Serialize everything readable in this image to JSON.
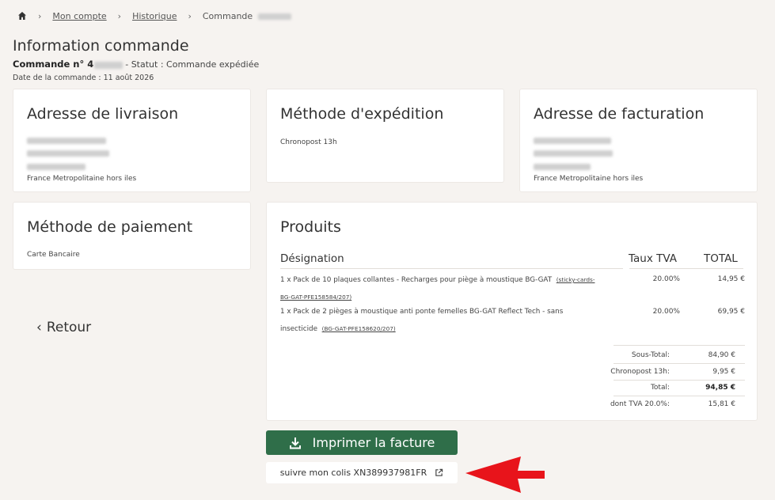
{
  "breadcrumb": {
    "home_icon": "home-icon",
    "items": [
      "Mon compte",
      "Historique"
    ],
    "current": "Commande"
  },
  "page_title": "Information commande",
  "order": {
    "label": "Commande n° 4",
    "status": "- Statut : Commande expédiée",
    "date": "Date de la commande : 11 août 2026"
  },
  "shipping_address": {
    "title": "Adresse de livraison",
    "country": "France Metropolitaine hors iles"
  },
  "shipping_method": {
    "title": "Méthode d'expédition",
    "value": "Chronopost 13h"
  },
  "billing_address": {
    "title": "Adresse de facturation",
    "country": "France Metropolitaine hors iles"
  },
  "payment": {
    "title": "Méthode de paiement",
    "value": "Carte Bancaire"
  },
  "back_label": "Retour",
  "products": {
    "title": "Produits",
    "headers": [
      "Désignation",
      "Taux TVA",
      "TOTAL"
    ],
    "rows": [
      {
        "line1": "1 x Pack de 10 plaques collantes - Recharges pour piège à moustique BG-GAT",
        "ref1": "(sticky-cards-",
        "ref2": "BG-GAT-PFE158584/207)",
        "tva": "20.00%",
        "total": "14,95 €"
      },
      {
        "line1": "1 x Pack de 2 pièges à moustique anti ponte femelles BG-GAT Reflect Tech - sans",
        "line2": "insecticide",
        "ref": "(BG-GAT-PFE158620/207)",
        "tva": "20.00%",
        "total": "69,95 €"
      }
    ],
    "totals": [
      {
        "label": "Sous-Total:",
        "value": "84,90 €"
      },
      {
        "label": "Chronopost 13h:",
        "value": "9,95 €"
      },
      {
        "label": "Total:",
        "value": "94,85 €"
      },
      {
        "label": "dont TVA 20.0%:",
        "value": "15,81 €"
      }
    ]
  },
  "print_button": "Imprimer la facture",
  "track_button": "suivre mon colis XN389937981FR",
  "colors": {
    "background": "#f6f3f0",
    "primary_button": "#2f6e49",
    "annotation_arrow": "#e8141b"
  }
}
